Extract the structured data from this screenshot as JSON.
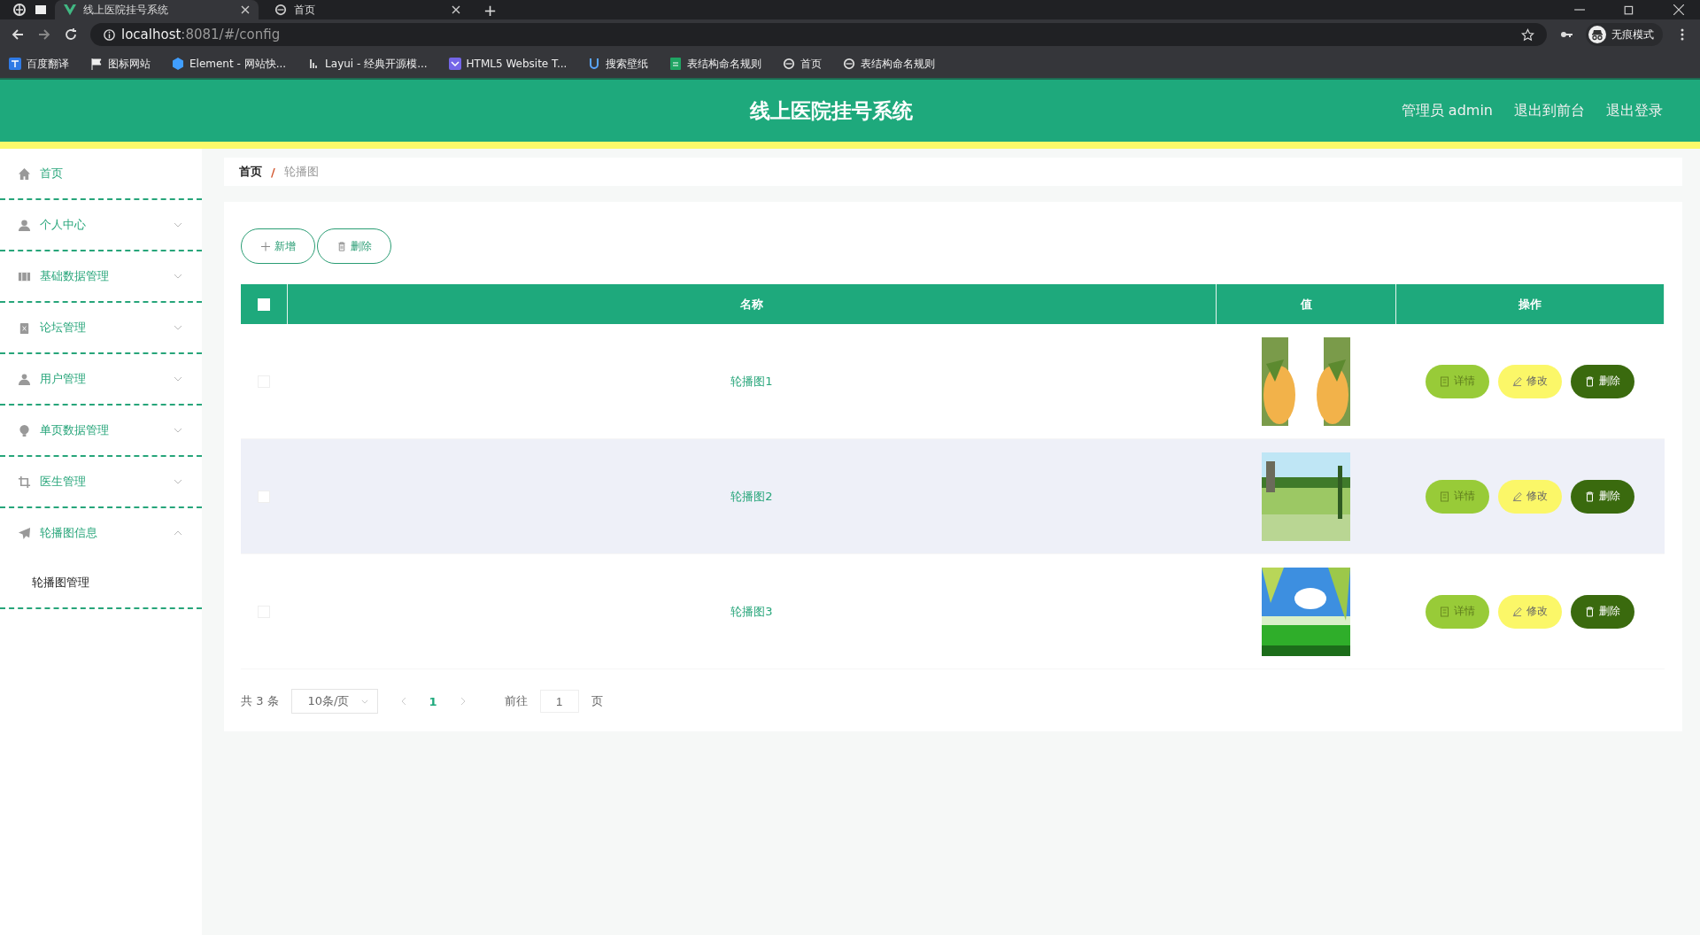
{
  "browser": {
    "tabs": [
      {
        "title": "线上医院挂号系统",
        "selected": true
      },
      {
        "title": "首页",
        "selected": false
      }
    ],
    "new_tab": "+",
    "address": {
      "host": "localhost",
      "rest": ":8081/#/config"
    },
    "profile": "无痕模式",
    "bookmarks": [
      {
        "label": "百度翻译",
        "kind": "translate"
      },
      {
        "label": "图标网站",
        "kind": "flag"
      },
      {
        "label": "Element - 网站快...",
        "kind": "hex"
      },
      {
        "label": "Layui - 经典开源模...",
        "kind": "layui"
      },
      {
        "label": "HTML5 Website T...",
        "kind": "square"
      },
      {
        "label": "搜索壁纸",
        "kind": "u"
      },
      {
        "label": "表结构命名规则",
        "kind": "sheet"
      },
      {
        "label": "首页",
        "kind": "globe"
      },
      {
        "label": "表结构命名规则",
        "kind": "globe"
      }
    ]
  },
  "header": {
    "title": "线上医院挂号系统",
    "links": [
      "管理员 admin",
      "退出到前台",
      "退出登录"
    ]
  },
  "sidebar": {
    "items": [
      {
        "label": "首页",
        "kind": "home"
      },
      {
        "label": "个人中心",
        "kind": "user",
        "expanded": false
      },
      {
        "label": "基础数据管理",
        "kind": "film",
        "expanded": false
      },
      {
        "label": "论坛管理",
        "kind": "clipboard",
        "expanded": false
      },
      {
        "label": "用户管理",
        "kind": "users",
        "expanded": false
      },
      {
        "label": "单页数据管理",
        "kind": "bulb",
        "expanded": false
      },
      {
        "label": "医生管理",
        "kind": "crop",
        "expanded": false
      },
      {
        "label": "轮播图信息",
        "kind": "plane",
        "expanded": true,
        "children": [
          {
            "label": "轮播图管理"
          }
        ]
      }
    ]
  },
  "breadcrumb": {
    "items": [
      "首页",
      "轮播图"
    ],
    "separator": "/"
  },
  "toolbar": [
    {
      "label": "新增",
      "kind": "add"
    },
    {
      "label": "删除",
      "kind": "delete"
    }
  ],
  "table": {
    "select_all": {
      "checked": false
    },
    "columns": [
      "名称",
      "值",
      "操作"
    ],
    "rows": [
      {
        "name": "轮播图1",
        "checked": false,
        "highlighted": false,
        "actions": [
          {
            "label": "详情",
            "kind": "detail"
          },
          {
            "label": "修改",
            "kind": "edit"
          },
          {
            "label": "删除",
            "kind": "delete"
          }
        ]
      },
      {
        "name": "轮播图2",
        "checked": false,
        "highlighted": true,
        "actions": [
          {
            "label": "详情",
            "kind": "detail"
          },
          {
            "label": "修改",
            "kind": "edit"
          },
          {
            "label": "删除",
            "kind": "delete"
          }
        ]
      },
      {
        "name": "轮播图3",
        "checked": false,
        "highlighted": false,
        "actions": [
          {
            "label": "详情",
            "kind": "detail"
          },
          {
            "label": "修改",
            "kind": "edit"
          },
          {
            "label": "删除",
            "kind": "delete"
          }
        ]
      }
    ]
  },
  "pagination": {
    "total": "共 3 条",
    "page_size": "10条/页",
    "pages": [
      {
        "label": "1",
        "selected": true
      }
    ],
    "goto_label": "前往",
    "goto_value": "1",
    "page_label": "页"
  }
}
